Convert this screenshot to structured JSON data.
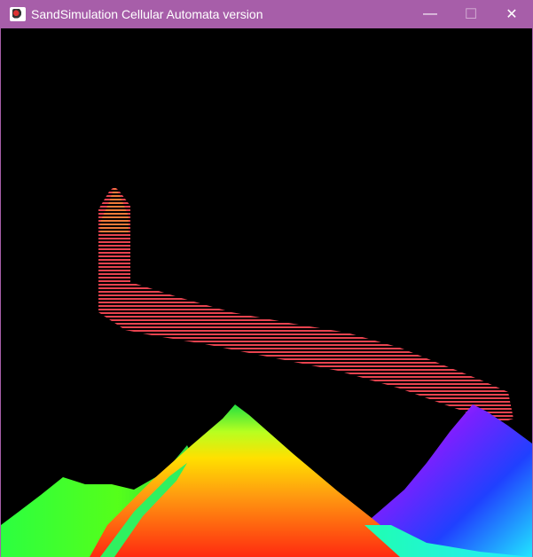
{
  "window": {
    "title": "SandSimulation Cellular Automata version",
    "controls": {
      "minimize": "—",
      "maximize": "☐",
      "close": "✕"
    }
  },
  "colors": {
    "titlebar": "#a75ea9",
    "canvas_bg": "#000000",
    "stream": "#e8434f",
    "stream_head": "#f07a3a"
  },
  "icons": {
    "app": "sand-simulation-app-icon",
    "minimize": "minimize-icon",
    "maximize": "maximize-icon",
    "close": "close-icon"
  }
}
